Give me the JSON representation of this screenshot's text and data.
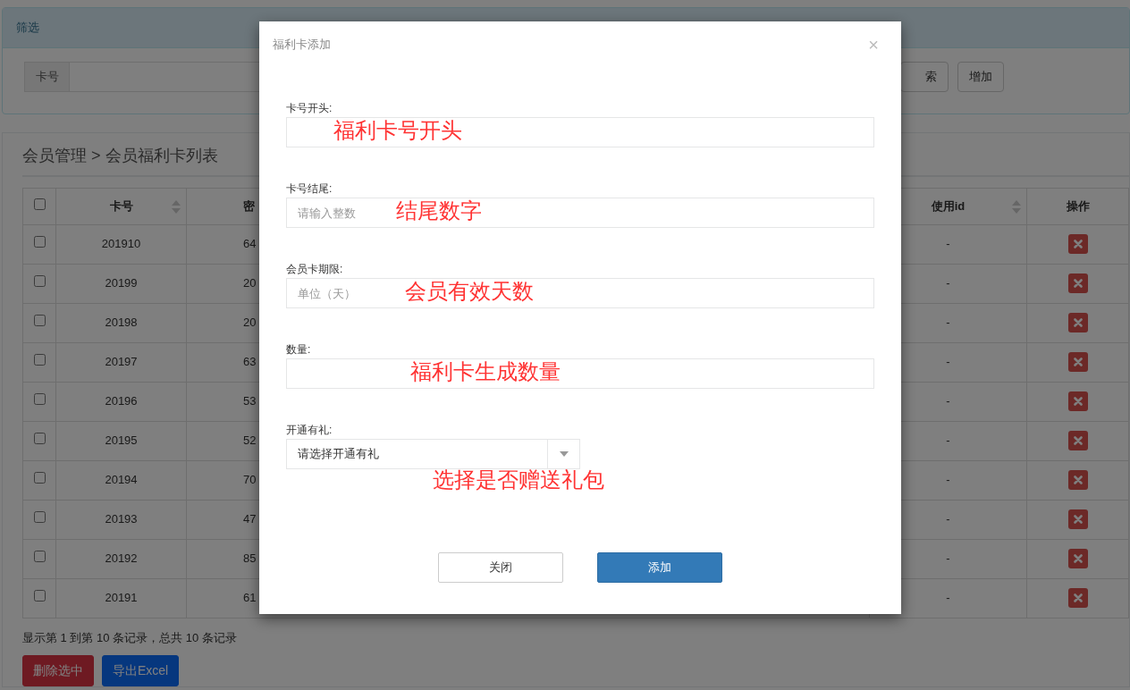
{
  "filter_panel": {
    "title": "筛选",
    "card_field": {
      "label": "卡号"
    },
    "buttons": [
      "索",
      "增加"
    ]
  },
  "list_panel": {
    "breadcrumb": "会员管理 > 会员福利卡列表",
    "table": {
      "select_all_checked": false,
      "columns": [
        {
          "label": "卡号",
          "sortable": true
        },
        {
          "label": "密",
          "sortable": false
        },
        {
          "label": "使用id",
          "sortable": true
        },
        {
          "label": "操作",
          "sortable": false
        }
      ],
      "rows": [
        {
          "checked": false,
          "card_no": "201910",
          "password": "64",
          "used_id": "-"
        },
        {
          "checked": false,
          "card_no": "20199",
          "password": "20",
          "used_id": "-"
        },
        {
          "checked": false,
          "card_no": "20198",
          "password": "20",
          "used_id": "-"
        },
        {
          "checked": false,
          "card_no": "20197",
          "password": "63",
          "used_id": "-"
        },
        {
          "checked": false,
          "card_no": "20196",
          "password": "53",
          "used_id": "-"
        },
        {
          "checked": false,
          "card_no": "20195",
          "password": "52",
          "used_id": "-"
        },
        {
          "checked": false,
          "card_no": "20194",
          "password": "70",
          "used_id": "-"
        },
        {
          "checked": false,
          "card_no": "20193",
          "password": "47",
          "used_id": "-"
        },
        {
          "checked": false,
          "card_no": "20192",
          "password": "85",
          "used_id": "-"
        },
        {
          "checked": false,
          "card_no": "20191",
          "password": "61",
          "used_id": "-"
        }
      ]
    },
    "summary": "显示第 1 到第 10 条记录，总共 10 条记录",
    "buttons": [
      {
        "label": "删除选中",
        "kind": "danger"
      },
      {
        "label": "导出Excel",
        "kind": "primary"
      }
    ]
  },
  "modal": {
    "title": "福利卡添加",
    "close": "×",
    "fields": [
      {
        "kind": "text",
        "label": "卡号开头:",
        "annotation": "福利卡号开头"
      },
      {
        "kind": "text",
        "label": "卡号结尾:",
        "placeholder": "请输入整数",
        "annotation": "结尾数字"
      },
      {
        "kind": "text",
        "label": "会员卡期限:",
        "placeholder": "单位（天）",
        "annotation": "会员有效天数"
      },
      {
        "kind": "text",
        "label": "数量:",
        "annotation": "福利卡生成数量"
      },
      {
        "kind": "select",
        "label": "开通有礼:",
        "value": "请选择开通有礼",
        "annotation": "选择是否赠送礼包"
      }
    ],
    "buttons": [
      {
        "label": "关闭",
        "kind": "secondary"
      },
      {
        "label": "添加",
        "kind": "primary"
      }
    ]
  }
}
